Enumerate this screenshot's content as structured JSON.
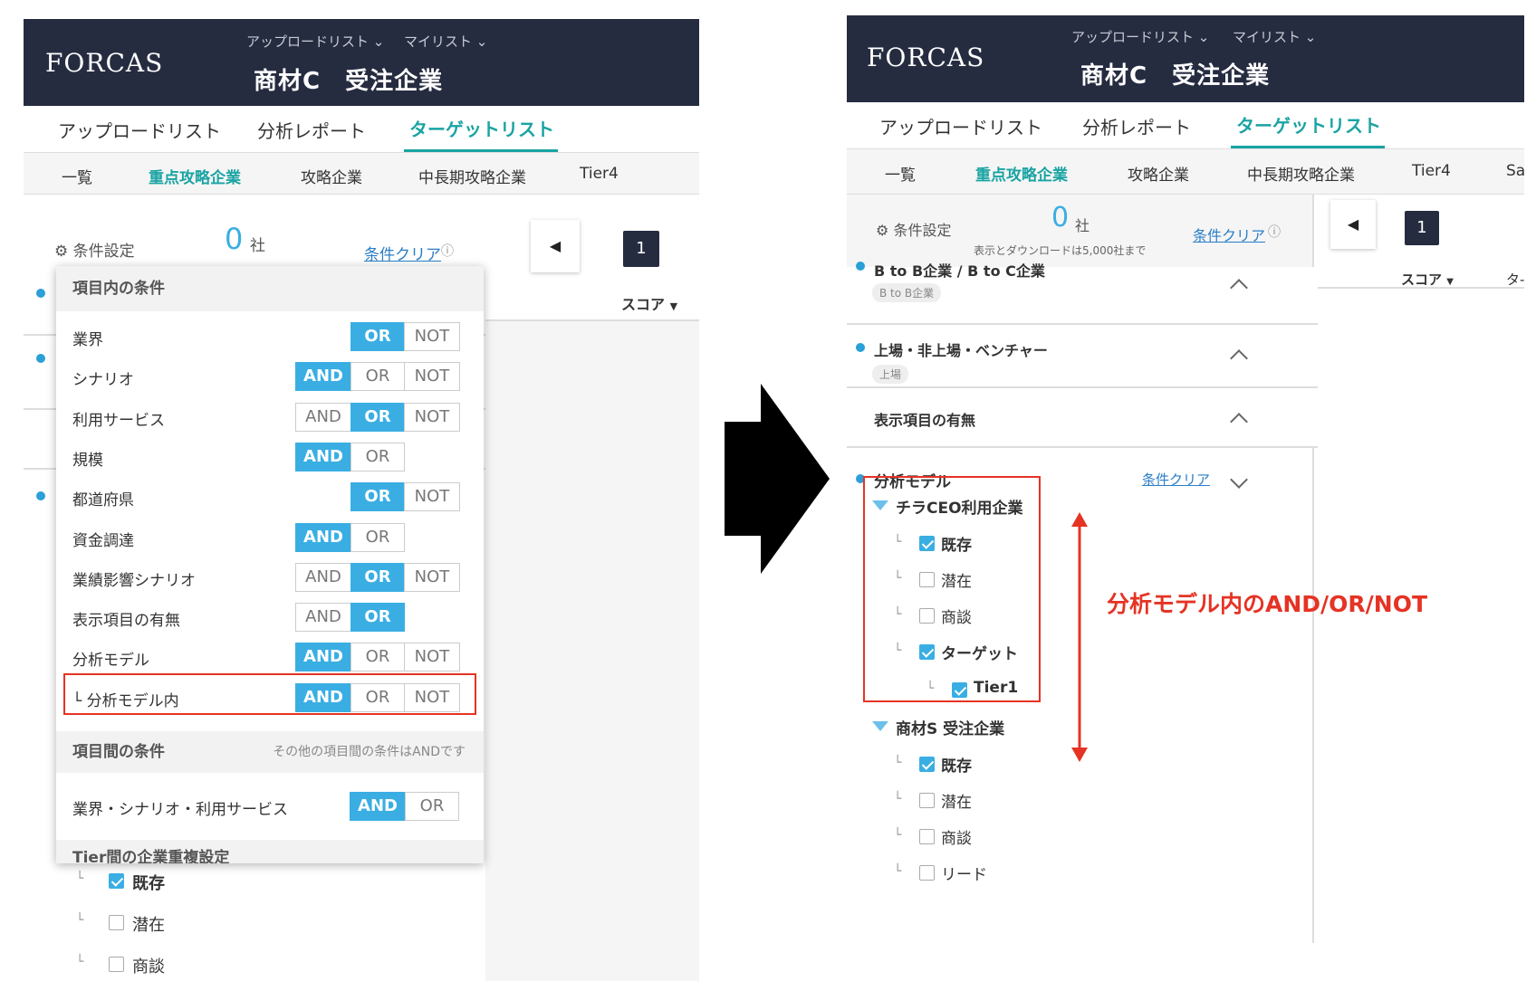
{
  "header": {
    "logo": "FORCAS",
    "upload_list_menu": "アップロードリスト",
    "my_list_menu": "マイリスト",
    "title": "商材C　受注企業"
  },
  "tabs": [
    "アップロードリスト",
    "分析レポート",
    "ターゲットリスト"
  ],
  "active_tab": "ターゲットリスト",
  "subtabs_left": [
    "一覧",
    "重点攻略企業",
    "攻略企業",
    "中長期攻略企業",
    "Tier4"
  ],
  "subtabs_right": [
    "一覧",
    "重点攻略企業",
    "攻略企業",
    "中長期攻略企業",
    "Tier4",
    "Sa"
  ],
  "toolbar": {
    "condition_settings": "条件設定",
    "count_number": "0",
    "count_unit": "社",
    "clear_conditions": "条件クリア",
    "download_note": "表示とダウンロードは5,000社まで",
    "page": "1",
    "score_col": "スコア",
    "next_col": "タ-"
  },
  "popup": {
    "section_within": "項目内の条件",
    "section_between": "項目間の条件",
    "between_note": "その他の項目間の条件はANDです",
    "section_tier": "Tier間の企業重複設定",
    "rows": [
      {
        "label": "業界",
        "options": [
          "OR",
          "NOT"
        ],
        "selected": "OR"
      },
      {
        "label": "シナリオ",
        "options": [
          "AND",
          "OR",
          "NOT"
        ],
        "selected": "AND"
      },
      {
        "label": "利用サービス",
        "options": [
          "AND",
          "OR",
          "NOT"
        ],
        "selected": "OR"
      },
      {
        "label": "規模",
        "options": [
          "AND",
          "OR"
        ],
        "selected": "AND"
      },
      {
        "label": "都道府県",
        "options": [
          "OR",
          "NOT"
        ],
        "selected": "OR"
      },
      {
        "label": "資金調達",
        "options": [
          "AND",
          "OR"
        ],
        "selected": "AND"
      },
      {
        "label": "業績影響シナリオ",
        "options": [
          "AND",
          "OR",
          "NOT"
        ],
        "selected": "OR"
      },
      {
        "label": "表示項目の有無",
        "options": [
          "AND",
          "OR"
        ],
        "selected": "OR"
      },
      {
        "label": "分析モデル",
        "options": [
          "AND",
          "OR",
          "NOT"
        ],
        "selected": "AND"
      },
      {
        "label": "└ 分析モデル内",
        "options": [
          "AND",
          "OR",
          "NOT"
        ],
        "selected": "AND"
      }
    ],
    "between_row": {
      "label": "業界・シナリオ・利用サービス",
      "options": [
        "AND",
        "OR"
      ],
      "selected": "AND"
    }
  },
  "left_bottom_items": [
    {
      "label": "既存",
      "checked": true
    },
    {
      "label": "潜在",
      "checked": false
    },
    {
      "label": "商談",
      "checked": false
    }
  ],
  "right_sections": {
    "btob": {
      "title": "B to B企業 / B to C企業",
      "tag": "B to B企業"
    },
    "listing": {
      "title": "上場・非上場・ベンチャー",
      "tag": "上場"
    },
    "display_items": {
      "title": "表示項目の有無"
    },
    "model": {
      "title": "分析モデル",
      "clear": "条件クリア"
    }
  },
  "model_tree": [
    {
      "group": "チラCEO利用企業",
      "items": [
        {
          "label": "既存",
          "checked": true
        },
        {
          "label": "潜在",
          "checked": false
        },
        {
          "label": "商談",
          "checked": false
        },
        {
          "label": "ターゲット",
          "checked": true
        },
        {
          "label": "Tier1",
          "checked": true,
          "nested": true
        }
      ]
    },
    {
      "group": "商材S 受注企業",
      "items": [
        {
          "label": "既存",
          "checked": true
        },
        {
          "label": "潜在",
          "checked": false
        },
        {
          "label": "商談",
          "checked": false
        },
        {
          "label": "リード",
          "checked": false
        }
      ]
    }
  ],
  "annotation": "分析モデル内のAND/OR/NOT",
  "colors": {
    "header_bg": "#262c40",
    "accent": "#1aa3a3",
    "seg_on": "#3aaee3",
    "highlight": "#e53324"
  }
}
